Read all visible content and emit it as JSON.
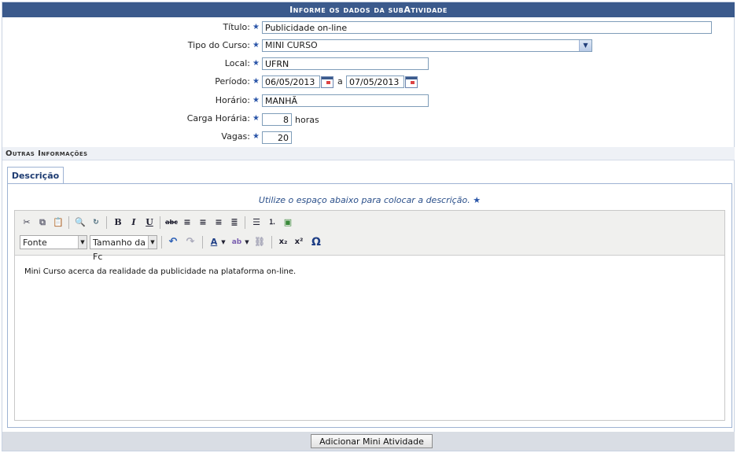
{
  "form": {
    "title": "Informe os dados da subAtividade",
    "fields": {
      "titulo": {
        "label": "Título:",
        "value": "Publicidade on-line"
      },
      "tipo_curso": {
        "label": "Tipo do Curso:",
        "value": "MINI CURSO"
      },
      "local": {
        "label": "Local:",
        "value": "UFRN"
      },
      "periodo": {
        "label": "Período:",
        "start": "06/05/2013",
        "separator": "a",
        "end": "07/05/2013"
      },
      "horario": {
        "label": "Horário:",
        "value": "MANHÃ"
      },
      "carga_horaria": {
        "label": "Carga Horária:",
        "value": "8",
        "unit": "horas"
      },
      "vagas": {
        "label": "Vagas:",
        "value": "20"
      }
    },
    "required_mark": "★"
  },
  "other_info": {
    "section_title": "Outras Informações",
    "tab_label": "Descrição",
    "hint": "Utilize o espaço abaixo para colocar a descrição.",
    "editor": {
      "font_select": "Fonte",
      "size_select": "Tamanho da Fc",
      "content": "Mini Curso acerca da realidade da publicidade na plataforma on-line."
    }
  },
  "footer": {
    "submit_label": "Adicionar Mini Atividade"
  },
  "colors": {
    "header": "#3b5a8c",
    "required_star": "#2a55a8"
  }
}
